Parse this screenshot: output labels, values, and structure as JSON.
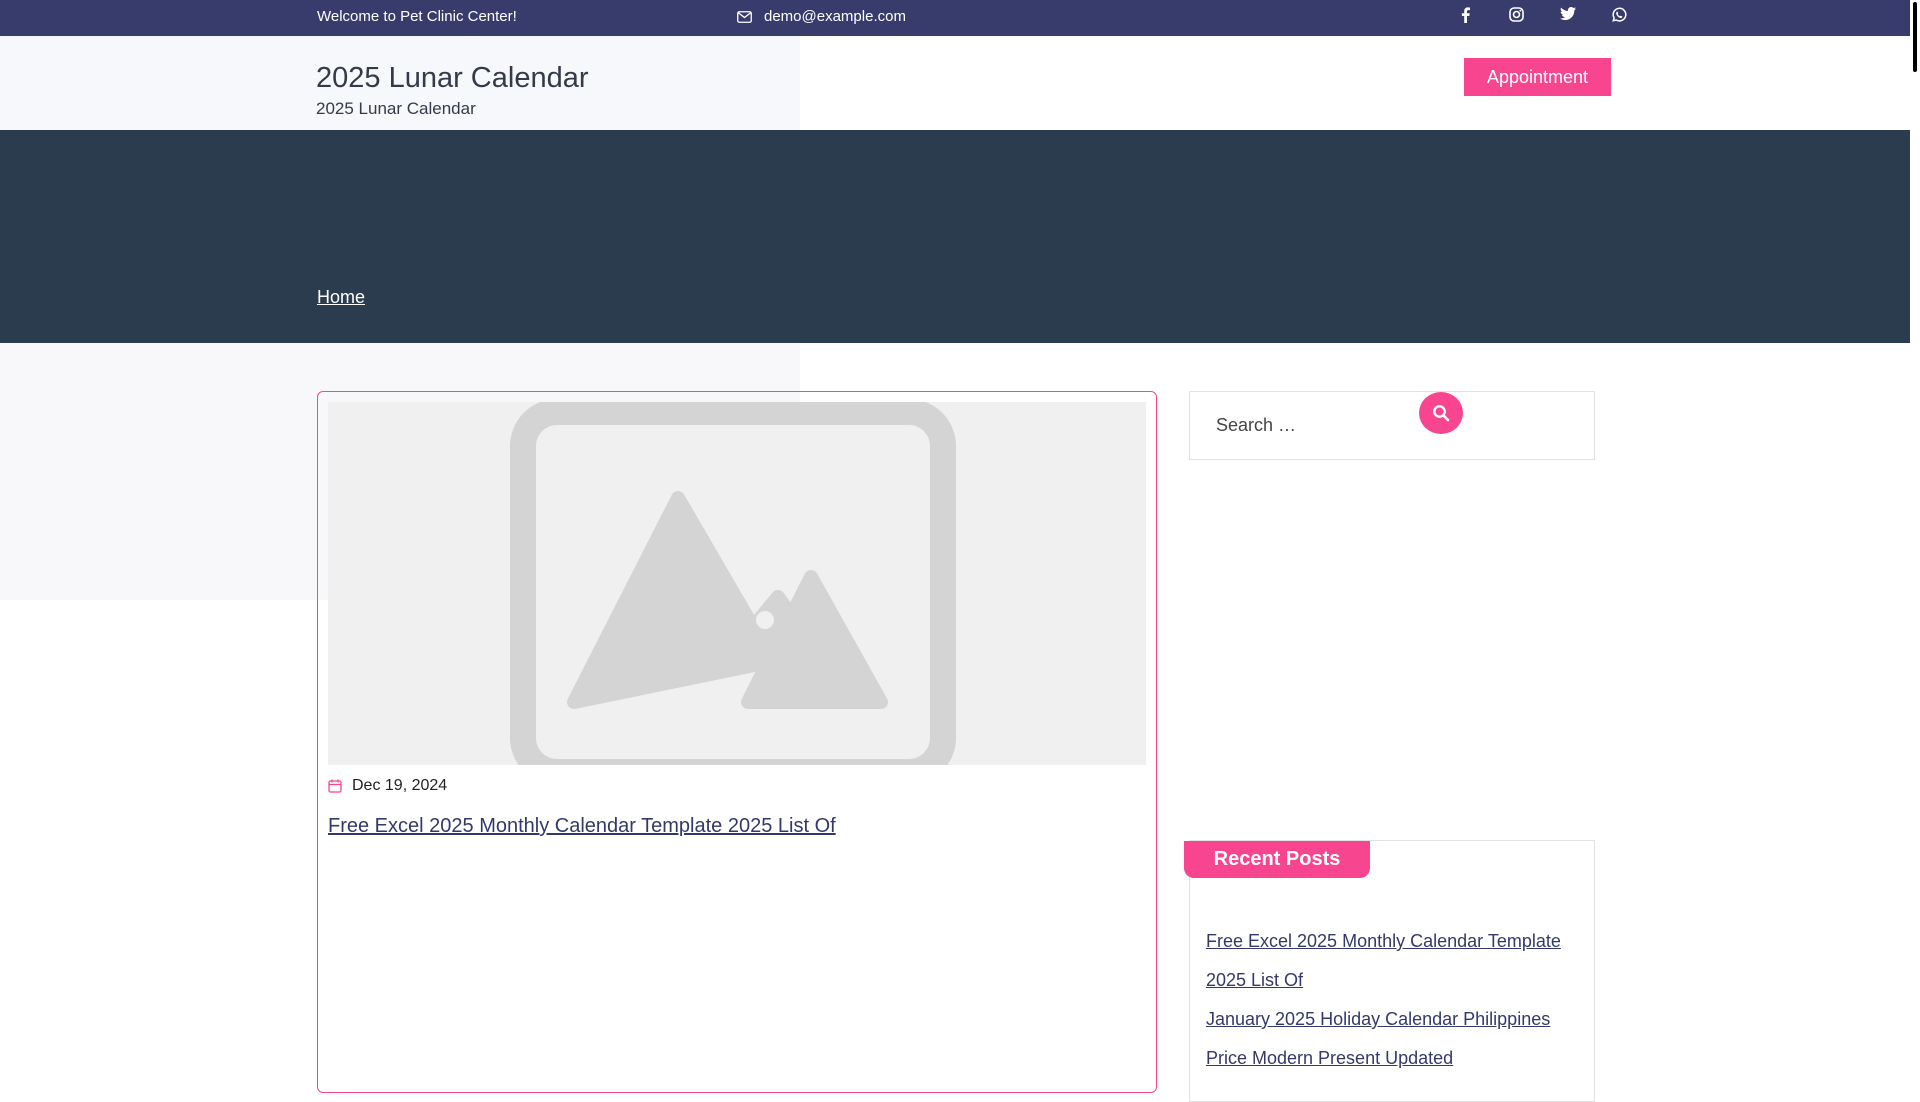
{
  "topbar": {
    "welcome": "Welcome to Pet Clinic Center!",
    "email": "demo@example.com",
    "social_icons": [
      "facebook-icon",
      "instagram-icon",
      "twitter-icon",
      "whatsapp-icon"
    ]
  },
  "header": {
    "site_title": "2025 Lunar Calendar",
    "site_tagline": "2025 Lunar Calendar",
    "appointment_label": "Appointment"
  },
  "hero": {
    "breadcrumb_home": "Home"
  },
  "post": {
    "date": "Dec 19, 2024",
    "title": "Free Excel 2025 Monthly Calendar Template 2025 List Of"
  },
  "sidebar": {
    "search_placeholder": "Search …",
    "recent_posts_title": "Recent Posts",
    "recent_posts": [
      "Free Excel 2025 Monthly Calendar Template 2025 List Of",
      "January 2025 Holiday Calendar Philippines Price Modern Present Updated"
    ]
  },
  "colors": {
    "topbar": "#383c6d",
    "hero": "#2a3c4d",
    "accent": "#f7468f"
  }
}
